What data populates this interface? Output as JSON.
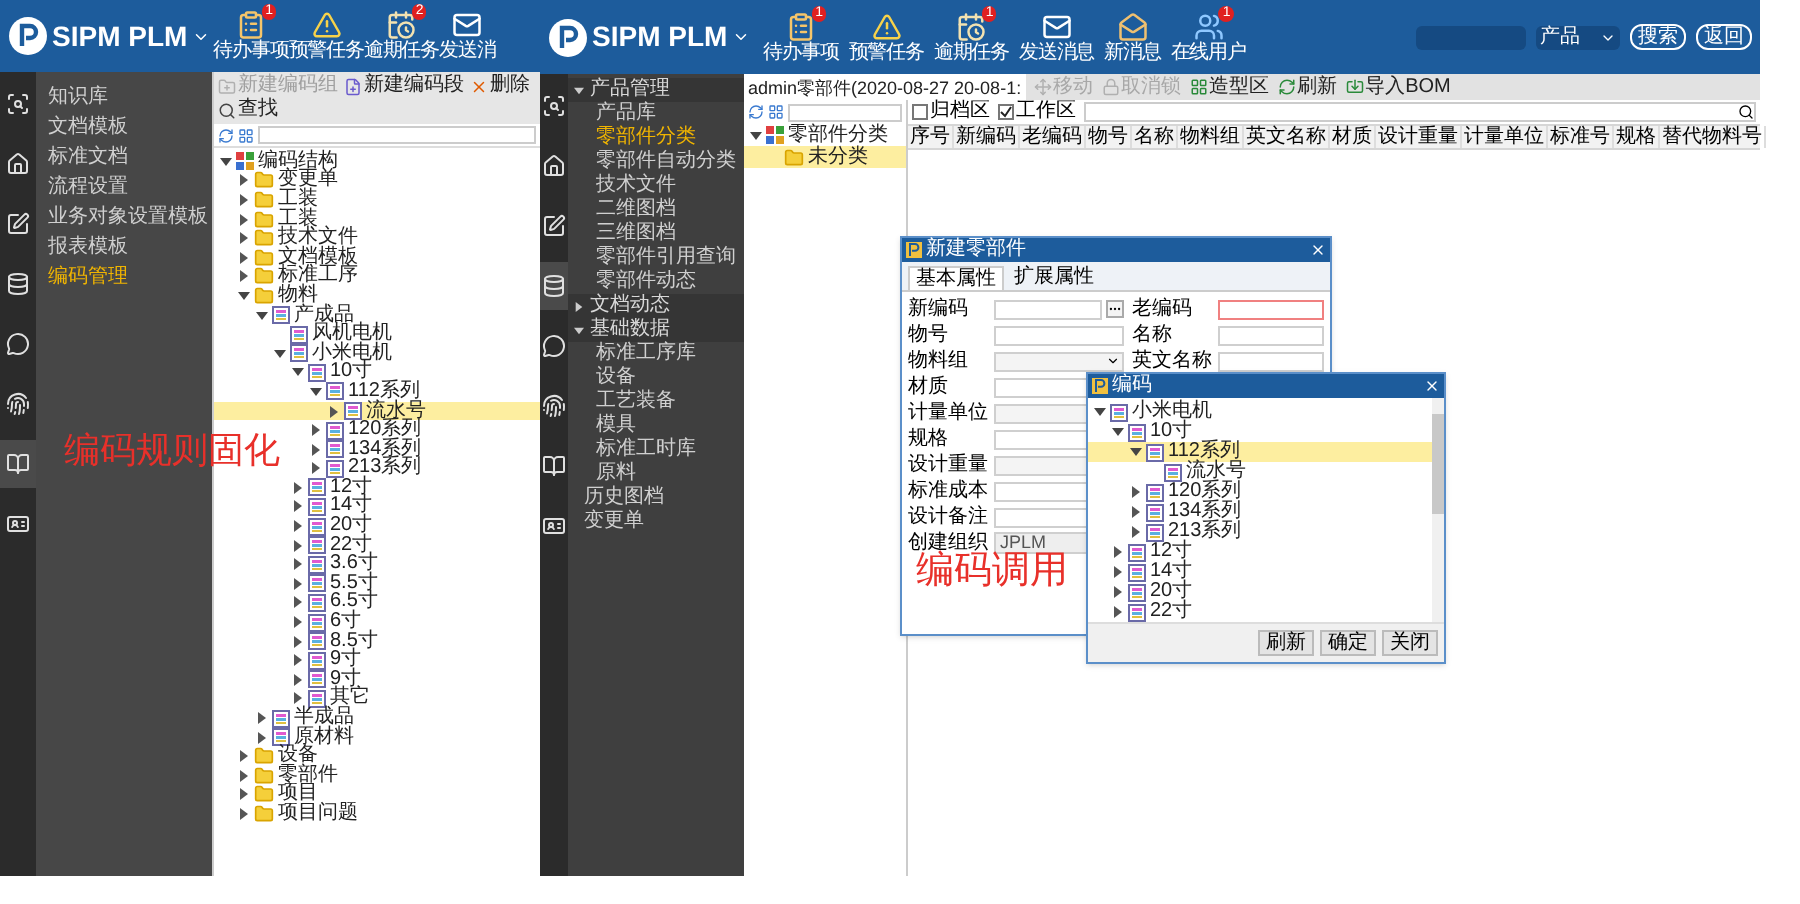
{
  "left_window": {
    "logo": "SIPM PLM",
    "toolbar": [
      {
        "label": "待办事项",
        "badge": "1"
      },
      {
        "label": "预警任务"
      },
      {
        "label": "逾期任务",
        "badge": "2"
      },
      {
        "label": "发送消"
      }
    ],
    "rail": [
      {
        "selected": false
      },
      {
        "selected": false
      },
      {
        "selected": false
      },
      {
        "selected": false
      },
      {
        "selected": false
      },
      {
        "selected": false
      },
      {
        "selected": true
      },
      {
        "selected": false
      }
    ],
    "nav": [
      {
        "label": "知识库",
        "selected": false
      },
      {
        "label": "文档模板",
        "selected": false
      },
      {
        "label": "标准文档",
        "selected": false
      },
      {
        "label": "流程设置",
        "selected": false
      },
      {
        "label": "业务对象设置模板",
        "selected": false
      },
      {
        "label": "报表模板",
        "selected": false
      },
      {
        "label": "编码管理",
        "selected": true
      }
    ],
    "tree_toolbar": [
      {
        "label": "新建编码组",
        "disabled": true
      },
      {
        "label": "新建编码段",
        "disabled": false
      },
      {
        "label": "删除",
        "disabled": false
      },
      {
        "label": "查找",
        "disabled": false
      }
    ],
    "tree": [
      {
        "label": "编码结构",
        "kind": "root",
        "expanded": true,
        "selected": false,
        "children": [
          {
            "label": "变更单",
            "kind": "folder",
            "expanded": false,
            "selected": false
          },
          {
            "label": "工装",
            "kind": "folder",
            "expanded": false,
            "selected": false
          },
          {
            "label": "工装",
            "kind": "folder",
            "expanded": false,
            "selected": false
          },
          {
            "label": "技术文件",
            "kind": "folder",
            "expanded": false,
            "selected": false
          },
          {
            "label": "文档模板",
            "kind": "folder",
            "expanded": false,
            "selected": false
          },
          {
            "label": "标准工序",
            "kind": "folder",
            "expanded": false,
            "selected": false
          },
          {
            "label": "物料",
            "kind": "folder",
            "expanded": true,
            "selected": false,
            "children": [
              {
                "label": "产成品",
                "kind": "item",
                "expanded": true,
                "selected": false,
                "children": [
                  {
                    "label": "风机电机",
                    "kind": "item",
                    "selected": false
                  },
                  {
                    "label": "小米电机",
                    "kind": "item",
                    "expanded": true,
                    "selected": false,
                    "children": [
                      {
                        "label": "10寸",
                        "kind": "item",
                        "expanded": true,
                        "selected": false,
                        "children": [
                          {
                            "label": "112系列",
                            "kind": "item",
                            "expanded": true,
                            "selected": false,
                            "children": [
                              {
                                "label": "流水号",
                                "kind": "item",
                                "expanded": false,
                                "selected": true
                              }
                            ]
                          },
                          {
                            "label": "120系列",
                            "kind": "item",
                            "expanded": false,
                            "selected": false
                          },
                          {
                            "label": "134系列",
                            "kind": "item",
                            "expanded": false,
                            "selected": false
                          },
                          {
                            "label": "213系列",
                            "kind": "item",
                            "expanded": false,
                            "selected": false
                          }
                        ]
                      },
                      {
                        "label": "12寸",
                        "kind": "item",
                        "expanded": false,
                        "selected": false
                      },
                      {
                        "label": "14寸",
                        "kind": "item",
                        "expanded": false,
                        "selected": false
                      },
                      {
                        "label": "20寸",
                        "kind": "item",
                        "expanded": false,
                        "selected": false
                      },
                      {
                        "label": "22寸",
                        "kind": "item",
                        "expanded": false,
                        "selected": false
                      },
                      {
                        "label": "3.6寸",
                        "kind": "item",
                        "expanded": false,
                        "selected": false
                      },
                      {
                        "label": "5.5寸",
                        "kind": "item",
                        "expanded": false,
                        "selected": false
                      },
                      {
                        "label": "6.5寸",
                        "kind": "item",
                        "expanded": false,
                        "selected": false
                      },
                      {
                        "label": "6寸",
                        "kind": "item",
                        "expanded": false,
                        "selected": false
                      },
                      {
                        "label": "8.5寸",
                        "kind": "item",
                        "expanded": false,
                        "selected": false
                      },
                      {
                        "label": "9寸",
                        "kind": "item",
                        "expanded": false,
                        "selected": false
                      },
                      {
                        "label": "9寸",
                        "kind": "item",
                        "expanded": false,
                        "selected": false
                      },
                      {
                        "label": "其它",
                        "kind": "item",
                        "expanded": false,
                        "selected": false
                      }
                    ]
                  }
                ]
              },
              {
                "label": "半成品",
                "kind": "item",
                "expanded": false,
                "selected": false
              },
              {
                "label": "原材料",
                "kind": "item",
                "expanded": false,
                "selected": false
              }
            ]
          },
          {
            "label": "设备",
            "kind": "folder",
            "expanded": false,
            "selected": false
          },
          {
            "label": "零部件",
            "kind": "folder",
            "expanded": false,
            "selected": false
          },
          {
            "label": "项目",
            "kind": "folder",
            "expanded": false,
            "selected": false
          },
          {
            "label": "项目问题",
            "kind": "folder",
            "expanded": false,
            "selected": false
          }
        ]
      }
    ]
  },
  "right_window": {
    "logo": "SIPM PLM",
    "toolbar": [
      {
        "label": "待办事项",
        "badge": "1"
      },
      {
        "label": "预警任务"
      },
      {
        "label": "逾期任务",
        "badge": "1"
      },
      {
        "label": "发送消息"
      },
      {
        "label": "新消息"
      },
      {
        "label": "在线用户",
        "badge": "1"
      }
    ],
    "scope_select": "产品",
    "buttons": [
      "搜索",
      "返回"
    ],
    "rail": [
      {
        "selected": false
      },
      {
        "selected": false
      },
      {
        "selected": false
      },
      {
        "selected": true
      },
      {
        "selected": false
      },
      {
        "selected": false
      },
      {
        "selected": false
      },
      {
        "selected": false
      }
    ],
    "nav": [
      {
        "kind": "group",
        "label": "产品管理",
        "expanded": true,
        "items": [
          {
            "label": "产品库",
            "selected": false
          },
          {
            "label": "零部件分类",
            "selected": true
          },
          {
            "label": "零部件自动分类",
            "selected": false
          },
          {
            "label": "技术文件",
            "selected": false
          },
          {
            "label": "二维图档",
            "selected": false
          },
          {
            "label": "三维图档",
            "selected": false
          },
          {
            "label": "零部件引用查询",
            "selected": false
          },
          {
            "label": "零部件动态",
            "selected": false
          }
        ]
      },
      {
        "kind": "group",
        "label": "文档动态",
        "expanded": false
      },
      {
        "kind": "group",
        "label": "基础数据",
        "expanded": true,
        "items": [
          {
            "label": "标准工序库",
            "selected": false
          },
          {
            "label": "设备",
            "selected": false
          },
          {
            "label": "工艺装备",
            "selected": false
          },
          {
            "label": "模具",
            "selected": false
          },
          {
            "label": "标准工时库",
            "selected": false
          },
          {
            "label": "原料",
            "selected": false
          }
        ]
      },
      {
        "kind": "link",
        "label": "历史图档",
        "selected": false
      },
      {
        "kind": "link",
        "label": "变更单",
        "selected": false
      }
    ],
    "tab": "admin零部件(2020-08-27 20-08-1:",
    "tools": [
      {
        "label": "移动",
        "disabled": true
      },
      {
        "label": "取消锁",
        "disabled": true
      },
      {
        "label": "造型区",
        "disabled": false
      },
      {
        "label": "刷新",
        "disabled": false
      },
      {
        "label": "导入BOM",
        "disabled": false
      }
    ],
    "class_tree": [
      {
        "label": "零部件分类",
        "kind": "root",
        "expanded": true,
        "selected": false,
        "children": [
          {
            "label": "未分类",
            "kind": "folder",
            "selected": true
          }
        ]
      }
    ],
    "filters": [
      {
        "label": "归档区",
        "checked": false
      },
      {
        "label": "工作区",
        "checked": true
      }
    ],
    "table": {
      "columns": [
        "序号",
        "新编码",
        "老编码",
        "物号",
        "名称",
        "物料组",
        "英文名称",
        "材质",
        "设计重量",
        "计量单位",
        "标准号",
        "规格",
        "替代物料号"
      ]
    },
    "new_part_dialog": {
      "title": "新建零部件",
      "tabs": [
        {
          "label": "基本属性",
          "selected": true
        },
        {
          "label": "扩展属性",
          "selected": false
        }
      ],
      "left_fields": [
        {
          "label": "新编码",
          "kind": "picker"
        },
        {
          "label": "物号",
          "kind": "text"
        },
        {
          "label": "物料组",
          "kind": "select"
        },
        {
          "label": "材质",
          "kind": "text"
        },
        {
          "label": "计量单位",
          "kind": "select"
        },
        {
          "label": "规格",
          "kind": "text"
        },
        {
          "label": "设计重量",
          "kind": "select"
        },
        {
          "label": "标准成本",
          "kind": "text"
        },
        {
          "label": "设计备注",
          "kind": "text"
        },
        {
          "label": "创建组织",
          "kind": "readonly",
          "value": "JPLM"
        }
      ],
      "right_fields": [
        {
          "label": "老编码",
          "kind": "text",
          "invalid": true
        },
        {
          "label": "名称",
          "kind": "text",
          "invalid": false
        },
        {
          "label": "英文名称",
          "kind": "text",
          "invalid": false
        }
      ]
    },
    "code_dialog": {
      "title": "编码",
      "tree": [
        {
          "label": "小米电机",
          "kind": "item",
          "expanded": true,
          "selected": false,
          "children": [
            {
              "label": "10寸",
              "kind": "item",
              "expanded": true,
              "selected": false,
              "children": [
                {
                  "label": "112系列",
                  "kind": "item",
                  "expanded": true,
                  "selected": true,
                  "children": [
                    {
                      "label": "流水号",
                      "kind": "item",
                      "selected": false
                    }
                  ]
                },
                {
                  "label": "120系列",
                  "kind": "item",
                  "expanded": false,
                  "selected": false
                },
                {
                  "label": "134系列",
                  "kind": "item",
                  "expanded": false,
                  "selected": false
                },
                {
                  "label": "213系列",
                  "kind": "item",
                  "expanded": false,
                  "selected": false
                }
              ]
            },
            {
              "label": "12寸",
              "kind": "item",
              "expanded": false,
              "selected": false
            },
            {
              "label": "14寸",
              "kind": "item",
              "expanded": false,
              "selected": false
            },
            {
              "label": "20寸",
              "kind": "item",
              "expanded": false,
              "selected": false
            },
            {
              "label": "22寸",
              "kind": "item",
              "expanded": false,
              "selected": false
            }
          ]
        }
      ],
      "buttons": [
        "刷新",
        "确定",
        "关闭"
      ]
    }
  },
  "annotations": [
    {
      "text": "编码规则固化"
    },
    {
      "text": "编码调用"
    }
  ]
}
